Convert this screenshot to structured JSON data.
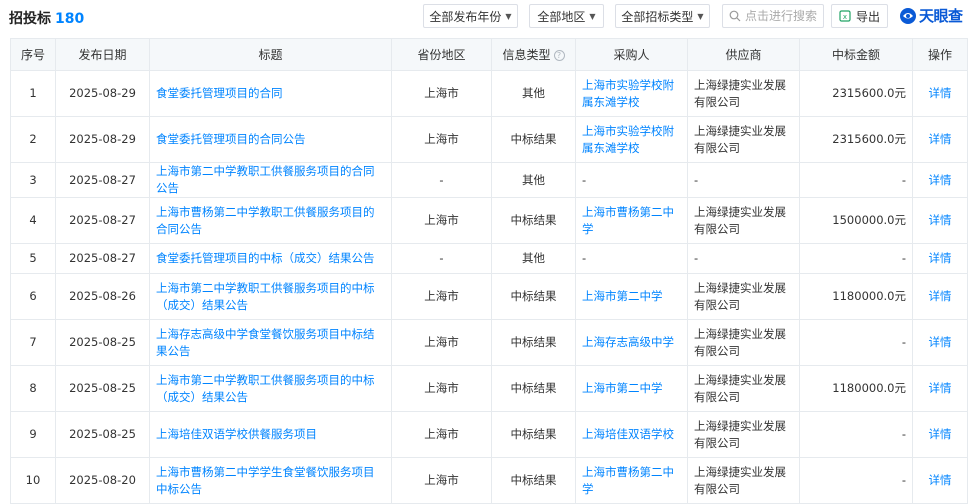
{
  "header": {
    "title": "招投标",
    "count": "180",
    "filters": [
      "全部发布年份",
      "全部地区",
      "全部招标类型"
    ],
    "search_placeholder": "点击进行搜索",
    "export_label": "导出",
    "logo_text": "天眼查"
  },
  "table": {
    "columns": [
      "序号",
      "发布日期",
      "标题",
      "省份地区",
      "信息类型",
      "采购人",
      "供应商",
      "中标金额",
      "操作"
    ],
    "rows": [
      {
        "no": "1",
        "date": "2025-08-29",
        "title": "食堂委托管理项目的合同",
        "region": "上海市",
        "type": "其他",
        "buyer": "上海市实验学校附属东滩学校",
        "supplier": "上海绿捷实业发展有限公司",
        "amount": "2315600.0元",
        "action": "详情"
      },
      {
        "no": "2",
        "date": "2025-08-29",
        "title": "食堂委托管理项目的合同公告",
        "region": "上海市",
        "type": "中标结果",
        "buyer": "上海市实验学校附属东滩学校",
        "supplier": "上海绿捷实业发展有限公司",
        "amount": "2315600.0元",
        "action": "详情"
      },
      {
        "no": "3",
        "date": "2025-08-27",
        "title": "上海市第二中学教职工供餐服务项目的合同公告",
        "region": "-",
        "type": "其他",
        "buyer": "-",
        "supplier": "-",
        "amount": "-",
        "action": "详情"
      },
      {
        "no": "4",
        "date": "2025-08-27",
        "title": "上海市曹杨第二中学教职工供餐服务项目的合同公告",
        "region": "上海市",
        "type": "中标结果",
        "buyer": "上海市曹杨第二中学",
        "supplier": "上海绿捷实业发展有限公司",
        "amount": "1500000.0元",
        "action": "详情"
      },
      {
        "no": "5",
        "date": "2025-08-27",
        "title": "食堂委托管理项目的中标（成交）结果公告",
        "region": "-",
        "type": "其他",
        "buyer": "-",
        "supplier": "-",
        "amount": "-",
        "action": "详情"
      },
      {
        "no": "6",
        "date": "2025-08-26",
        "title": "上海市第二中学教职工供餐服务项目的中标（成交）结果公告",
        "region": "上海市",
        "type": "中标结果",
        "buyer": "上海市第二中学",
        "supplier": "上海绿捷实业发展有限公司",
        "amount": "1180000.0元",
        "action": "详情"
      },
      {
        "no": "7",
        "date": "2025-08-25",
        "title": "上海存志高级中学食堂餐饮服务项目中标结果公告",
        "region": "上海市",
        "type": "中标结果",
        "buyer": "上海存志高级中学",
        "supplier": "上海绿捷实业发展有限公司",
        "amount": "-",
        "action": "详情"
      },
      {
        "no": "8",
        "date": "2025-08-25",
        "title": "上海市第二中学教职工供餐服务项目的中标（成交）结果公告",
        "region": "上海市",
        "type": "中标结果",
        "buyer": "上海市第二中学",
        "supplier": "上海绿捷实业发展有限公司",
        "amount": "1180000.0元",
        "action": "详情"
      },
      {
        "no": "9",
        "date": "2025-08-25",
        "title": "上海培佳双语学校供餐服务项目",
        "region": "上海市",
        "type": "中标结果",
        "buyer": "上海培佳双语学校",
        "supplier": "上海绿捷实业发展有限公司",
        "amount": "-",
        "action": "详情"
      },
      {
        "no": "10",
        "date": "2025-08-20",
        "title": "上海市曹杨第二中学学生食堂餐饮服务项目中标公告",
        "region": "上海市",
        "type": "中标结果",
        "buyer": "上海市曹杨第二中学",
        "supplier": "上海绿捷实业发展有限公司",
        "amount": "-",
        "action": "详情"
      }
    ]
  },
  "colors": {
    "accent": "#0084ff",
    "header_bg": "#f5f8fa",
    "border": "#e6eaee",
    "logo": "#0a5ad6"
  }
}
